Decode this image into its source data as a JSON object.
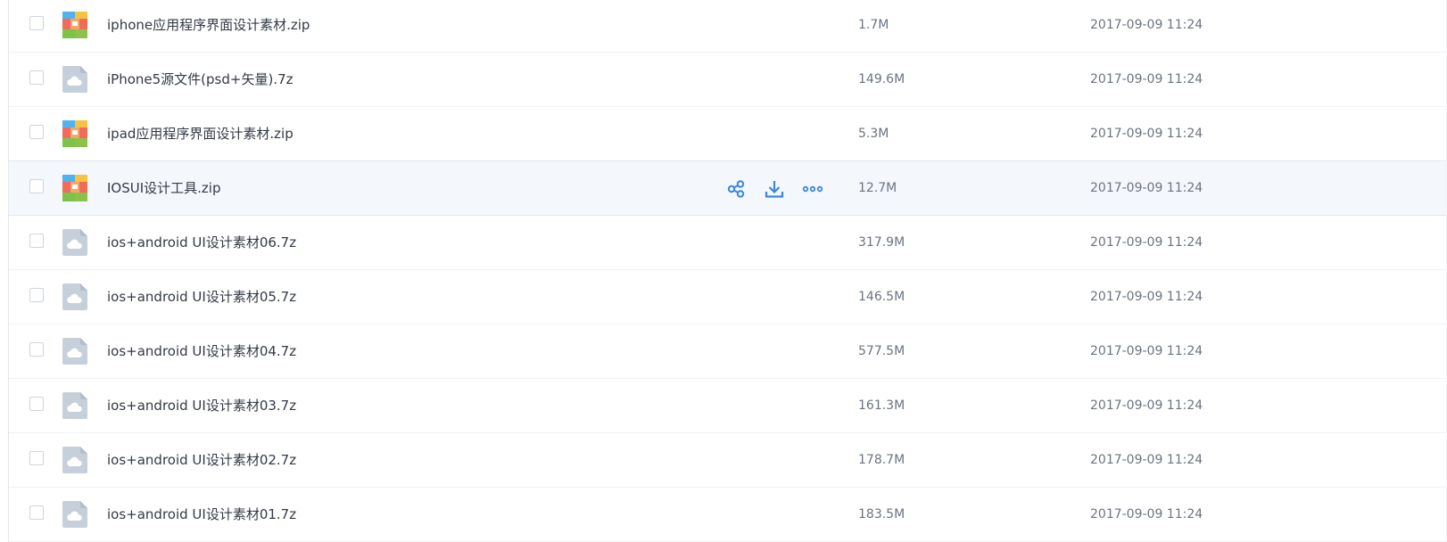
{
  "colors": {
    "accent": "#3b86e0",
    "row_hover": "#f4f8fd",
    "text_primary": "#333a45",
    "text_secondary": "#6b7380"
  },
  "icons": {
    "archive": "zip-archive-icon",
    "generic": "cloud-file-icon",
    "share": "share-icon",
    "download": "download-icon",
    "more": "more-icon"
  },
  "files": [
    {
      "name": "iphone应用程序界面设计素材.zip",
      "size": "1.7M",
      "date": "2017-09-09 11:24",
      "type": "zip"
    },
    {
      "name": "iPhone5源文件(psd+矢量).7z",
      "size": "149.6M",
      "date": "2017-09-09 11:24",
      "type": "generic"
    },
    {
      "name": "ipad应用程序界面设计素材.zip",
      "size": "5.3M",
      "date": "2017-09-09 11:24",
      "type": "zip"
    },
    {
      "name": "IOSUI设计工具.zip",
      "size": "12.7M",
      "date": "2017-09-09 11:24",
      "type": "zip",
      "hovered": true
    },
    {
      "name": "ios+android UI设计素材06.7z",
      "size": "317.9M",
      "date": "2017-09-09 11:24",
      "type": "generic"
    },
    {
      "name": "ios+android UI设计素材05.7z",
      "size": "146.5M",
      "date": "2017-09-09 11:24",
      "type": "generic"
    },
    {
      "name": "ios+android UI设计素材04.7z",
      "size": "577.5M",
      "date": "2017-09-09 11:24",
      "type": "generic"
    },
    {
      "name": "ios+android UI设计素材03.7z",
      "size": "161.3M",
      "date": "2017-09-09 11:24",
      "type": "generic"
    },
    {
      "name": "ios+android UI设计素材02.7z",
      "size": "178.7M",
      "date": "2017-09-09 11:24",
      "type": "generic"
    },
    {
      "name": "ios+android UI设计素材01.7z",
      "size": "183.5M",
      "date": "2017-09-09 11:24",
      "type": "generic"
    }
  ]
}
